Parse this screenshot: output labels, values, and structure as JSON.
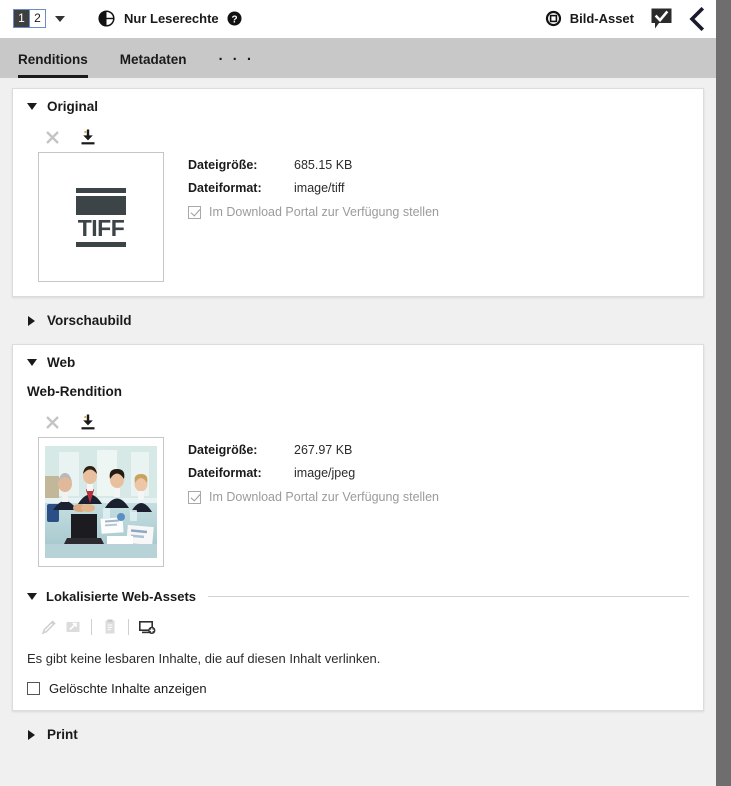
{
  "header": {
    "version_selector": {
      "selected": "1",
      "other": "2",
      "icon": "chevron-down-icon"
    },
    "permission": {
      "icon": "globe-permission-icon",
      "label": "Nur Leserechte",
      "help_icon": "help-circle-icon"
    },
    "asset_type": {
      "icon": "image-asset-icon",
      "label": "Bild-Asset"
    },
    "chat_icon": "comment-check-icon",
    "collapse_icon": "chevron-left-icon"
  },
  "tabs": [
    {
      "label": "Renditions",
      "active": true
    },
    {
      "label": "Metadaten",
      "active": false
    }
  ],
  "tabs_overflow_label": "· · ·",
  "sections": {
    "original": {
      "title": "Original",
      "expanded": true,
      "actions": {
        "delete_icon": "close-x-icon",
        "download_icon": "download-icon"
      },
      "thumbnail": {
        "type": "file-type-icon",
        "text": "TIFF"
      },
      "meta": {
        "size_key": "Dateigröße:",
        "size_value": "685.15 KB",
        "format_key": "Dateiformat:",
        "format_value": "image/tiff"
      },
      "portal_checkbox": {
        "label": "Im Download Portal zur Verfügung stellen",
        "checked": true,
        "disabled": true
      }
    },
    "vorschaubild": {
      "title": "Vorschaubild",
      "expanded": false
    },
    "web": {
      "title": "Web",
      "expanded": true,
      "rendition_title": "Web-Rendition",
      "actions": {
        "delete_icon": "close-x-icon",
        "download_icon": "download-icon"
      },
      "thumbnail": {
        "type": "photo",
        "alt": "business-meeting-photo"
      },
      "meta": {
        "size_key": "Dateigröße:",
        "size_value": "267.97 KB",
        "format_key": "Dateiformat:",
        "format_value": "image/jpeg"
      },
      "portal_checkbox": {
        "label": "Im Download Portal zur Verfügung stellen",
        "checked": true,
        "disabled": true
      },
      "localized": {
        "title": "Lokalisierte Web-Assets",
        "expanded": true,
        "toolbar": [
          "edit-pencil-icon",
          "open-external-icon",
          "copy-icon",
          "add-screen-icon"
        ],
        "empty_message": "Es gibt keine lesbaren Inhalte, die auf diesen Inhalt verlinken.",
        "show_deleted": {
          "label": "Gelöschte Inhalte anzeigen",
          "checked": false
        }
      }
    },
    "print": {
      "title": "Print",
      "expanded": false
    }
  },
  "colors": {
    "tabbar": "#c8c8c8",
    "page_bg": "#f0f0f0",
    "card_bg": "#ffffff",
    "accent_border": "#6c8cc8",
    "right_edge": "#6e6e6e"
  }
}
